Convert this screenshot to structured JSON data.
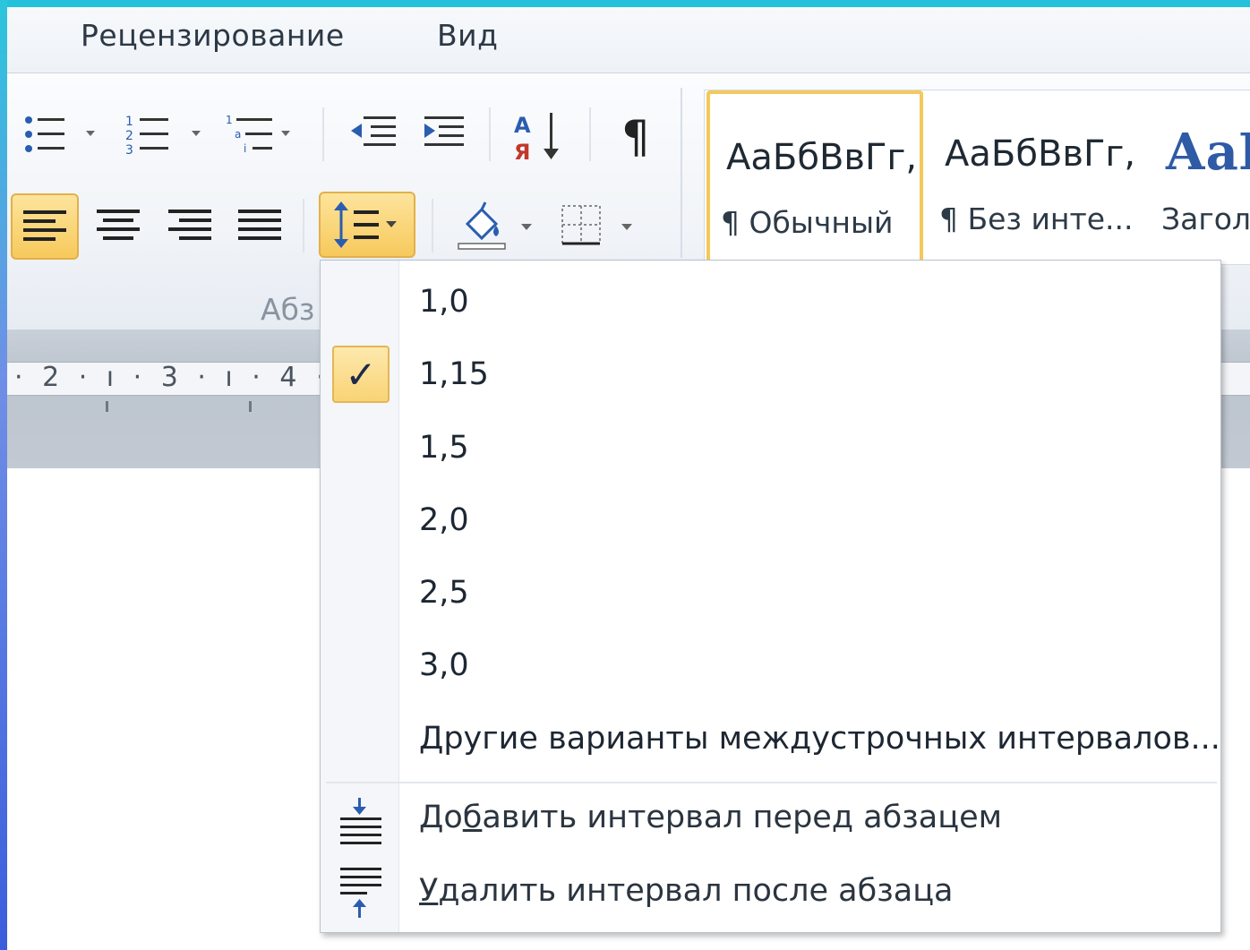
{
  "tabs": {
    "review": "Рецензирование",
    "view": "Вид"
  },
  "ribbon": {
    "group_label": "Абз",
    "styles": {
      "normal_sample": "АаБбВвГг,",
      "normal_name": "¶ Обычный",
      "nospacing_sample": "АаБбВвГг,",
      "nospacing_name": "¶ Без инте...",
      "heading_sample": "АаБ",
      "heading_name": "Загол"
    }
  },
  "ruler": {
    "marks": "· 2 · ı · 3 · ı · 4 ·"
  },
  "line_spacing_menu": {
    "options": [
      "1,0",
      "1,15",
      "1,5",
      "2,0",
      "2,5",
      "3,0"
    ],
    "selected": "1,15",
    "more_options": "Другие варианты междустрочных интервалов...",
    "add_space_before": {
      "pre": "До",
      "accel": "б",
      "post": "авить интервал перед абзацем"
    },
    "remove_space_after": {
      "pre": "",
      "accel": "У",
      "post": "далить интервал после абзаца"
    },
    "check_icon": "checkmark-icon"
  },
  "colors": {
    "highlight": "#f7c95c",
    "frame": "#24c1dc",
    "heading": "#2e5aa6"
  }
}
